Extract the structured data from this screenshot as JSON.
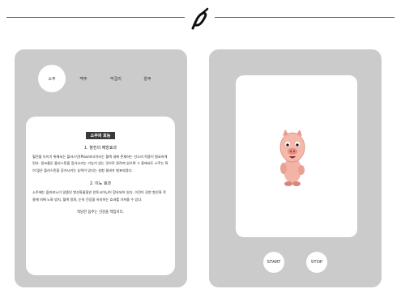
{
  "tabs": [
    {
      "label": "소주",
      "active": true
    },
    {
      "label": "맥주",
      "active": false
    },
    {
      "label": "막걸리",
      "active": false
    },
    {
      "label": "양주",
      "active": false
    }
  ],
  "doc": {
    "title": "소주의 효능",
    "section1_title": "1. 혈전의 예방효과",
    "section1_text": "혈전을 녹이기 위해서는 플라스민(Plasmin)이라는 혈액 내에 존재하는 선소의 작용이 필요하게 된다. 알코올은 플라스민을 증가시키는 기능이 있는 것으로 알려져 있으며 그 중에서도 소주는 특히 많은 플라스민을 증가시키는 능력이 있다는 실험 결과가 발표되었다.",
    "section2_title": "2. 이뇨 효과",
    "section2_text": "소주에는 플라보노이 일종인 항산화물질인 안토시아닌이 함유되어 있다. 이것이 강한 항산화 작용에 의해 노화 방지, 혈액 정화, 눈의 건강을 유지하는 효과를 가져올 수 있다.",
    "closing": "적당한 음주는 건강을 책임지다."
  },
  "controls": {
    "start": "START",
    "stop": "STOP"
  },
  "colors": {
    "panel": "#cbcbcb",
    "card": "#ffffff",
    "title_bg": "#3a3a3a"
  },
  "icons": {
    "logo": "ribbon-logo-icon",
    "character": "pink-pig-character"
  }
}
